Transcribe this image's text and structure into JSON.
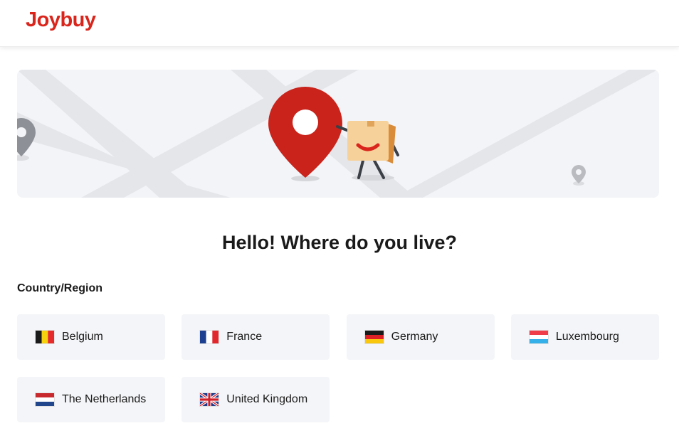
{
  "brand": {
    "logo_text": "Joybuy",
    "color": "#d9251c"
  },
  "headline": "Hello! Where do you live?",
  "section_label": "Country/Region",
  "countries": [
    {
      "label": "Belgium",
      "flag": "belgium-flag-icon"
    },
    {
      "label": "France",
      "flag": "france-flag-icon"
    },
    {
      "label": "Germany",
      "flag": "germany-flag-icon"
    },
    {
      "label": "Luxembourg",
      "flag": "luxembourg-flag-icon"
    },
    {
      "label": "The Netherlands",
      "flag": "netherlands-flag-icon"
    },
    {
      "label": "United Kingdom",
      "flag": "uk-flag-icon"
    }
  ],
  "colors": {
    "card_bg": "#f4f5f8",
    "banner_bg": "#f3f4f7",
    "pin_red": "#c9231b"
  }
}
